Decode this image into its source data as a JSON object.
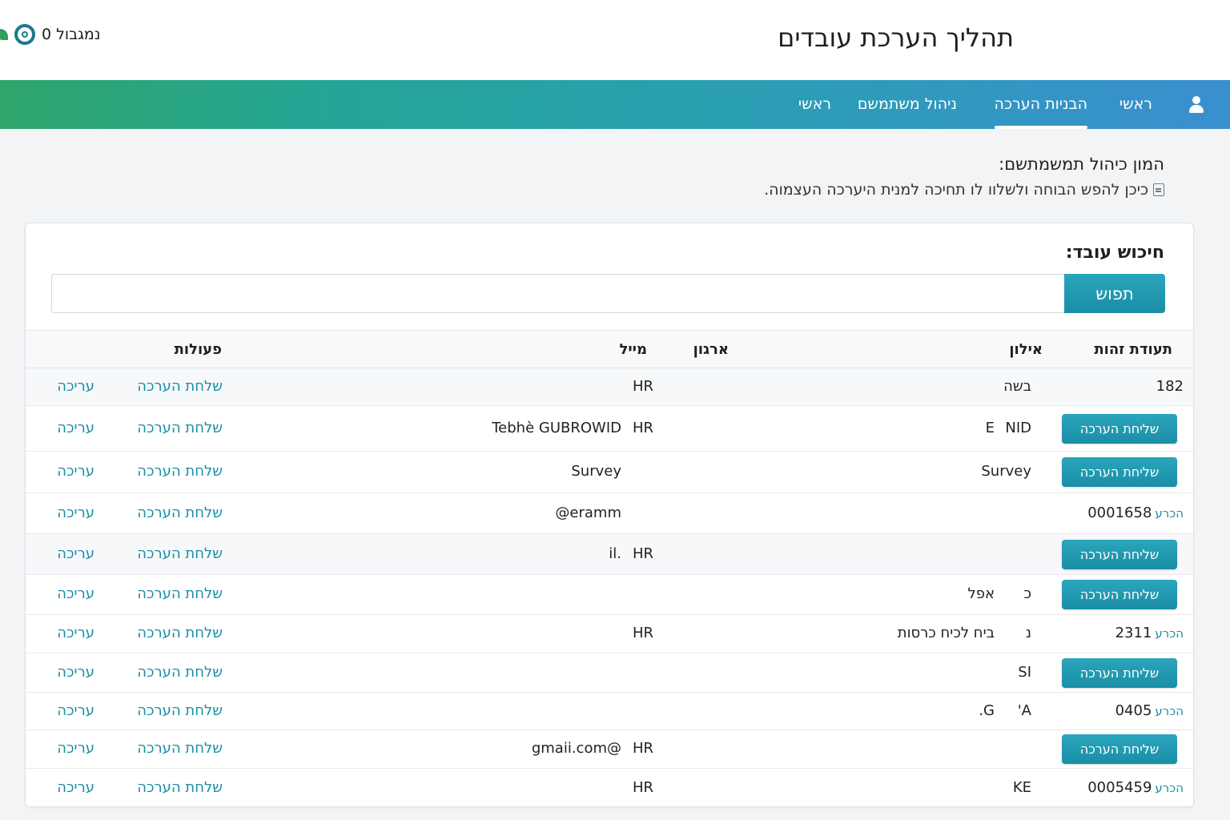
{
  "header": {
    "title": "תהליך הערכת עובדים",
    "status_text": "נמגבול 0"
  },
  "nav": {
    "items": [
      "ראשי",
      "הבניות הערכה",
      "ניהול משתמשם",
      "ראשי"
    ]
  },
  "intro": {
    "title": "המון כיהול תמשמתשם:",
    "description": "כיכן להפש הבוחה ולשלוו לו תחיכה למנית היערכה העצמוה."
  },
  "search": {
    "label": "חיכוש עובד:",
    "button_label": "תפוש",
    "value": ""
  },
  "table": {
    "headers": {
      "id": "תעודת זהות",
      "phone": "אילון",
      "org": "ארגון",
      "mail": "מייל",
      "actions": "פעולות"
    },
    "send_link": "שלחת הערכה",
    "edit_link": "עריכה",
    "row_button": "שליחת הערכה",
    "tag_label": "הכרע",
    "rows": [
      {
        "id": "182",
        "phone": "בשה",
        "org": "HR",
        "mail": "",
        "extra": ""
      },
      {
        "id": "",
        "phone": "NID",
        "org": "HR",
        "mail": "Tebhè GUBROWID",
        "extra": "E"
      },
      {
        "id": "",
        "phone": "Survey",
        "org": "",
        "mail": "Survey",
        "extra": ""
      },
      {
        "id": "0001658",
        "phone": "",
        "org": "",
        "mail": "eramm@",
        "extra": ""
      },
      {
        "id": "",
        "phone": "",
        "org": "HR",
        "mail": ".il",
        "extra": ""
      },
      {
        "id": "",
        "phone": "כ",
        "org": "",
        "mail": "",
        "extra": "אפל"
      },
      {
        "id": "2311",
        "phone": "נ",
        "org": "HR",
        "mail": "",
        "extra": "ביח לכיח כרסות"
      },
      {
        "id": "",
        "phone": "SI",
        "org": "",
        "mail": "",
        "extra": ""
      },
      {
        "id": "0405",
        "phone": "A'",
        "org": "",
        "mail": "",
        "extra": "G."
      },
      {
        "id": "",
        "phone": "",
        "org": "HR",
        "mail": "@gmaii.com",
        "extra": ""
      },
      {
        "id": "0005459",
        "phone": "KE",
        "org": "HR",
        "mail": "",
        "extra": ""
      }
    ]
  }
}
